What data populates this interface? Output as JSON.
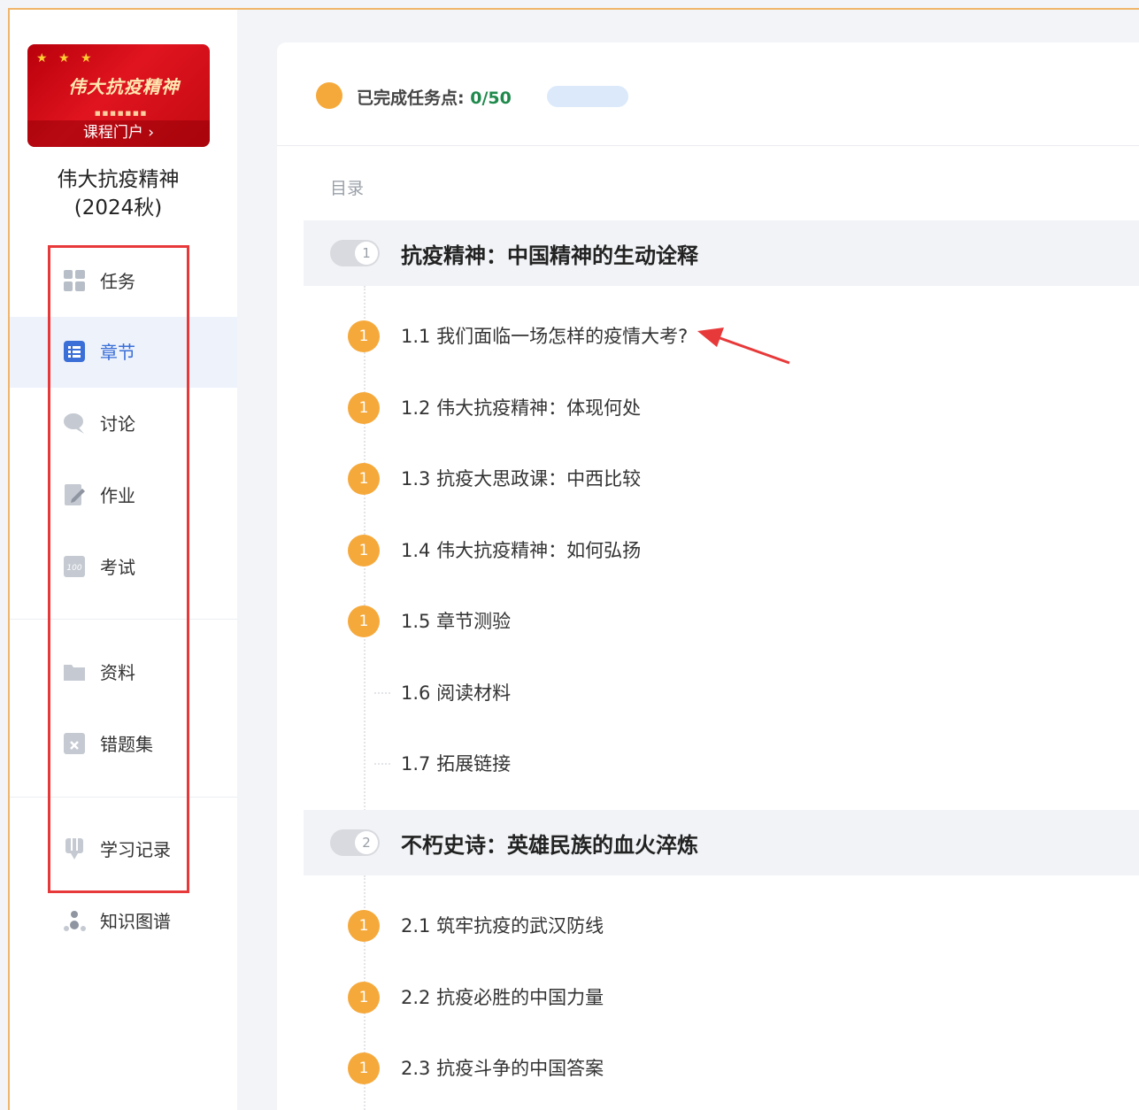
{
  "sidebar": {
    "banner": {
      "title": "伟大抗疫精神",
      "portal_label": "课程门户 ›"
    },
    "course_name_line1": "伟大抗疫精神",
    "course_name_line2": "(2024秋)",
    "nav": [
      {
        "label": "任务",
        "icon": "grid-icon"
      },
      {
        "label": "章节",
        "icon": "list-icon",
        "active": true
      },
      {
        "label": "讨论",
        "icon": "chat-bubble-icon"
      },
      {
        "label": "作业",
        "icon": "edit-document-icon"
      },
      {
        "label": "考试",
        "icon": "exam-score-icon"
      },
      {
        "label": "资料",
        "icon": "folder-icon"
      },
      {
        "label": "错题集",
        "icon": "wrong-questions-icon"
      },
      {
        "label": "学习记录",
        "icon": "bookmark-record-icon"
      },
      {
        "label": "知识图谱",
        "icon": "knowledge-graph-icon"
      }
    ]
  },
  "progress": {
    "label": "已完成任务点: ",
    "value": "0/50"
  },
  "toc_label": "目录",
  "chapters": [
    {
      "number": "1",
      "title": "抗疫精神：中国精神的生动诠释",
      "sections": [
        {
          "badge": "1",
          "title": "1.1 我们面临一场怎样的疫情大考?"
        },
        {
          "badge": "1",
          "title": "1.2 伟大抗疫精神：体现何处"
        },
        {
          "badge": "1",
          "title": "1.3 抗疫大思政课：中西比较"
        },
        {
          "badge": "1",
          "title": "1.4 伟大抗疫精神：如何弘扬"
        },
        {
          "badge": "1",
          "title": "1.5 章节测验"
        },
        {
          "badge": "",
          "title": "1.6 阅读材料"
        },
        {
          "badge": "",
          "title": "1.7 拓展链接"
        }
      ]
    },
    {
      "number": "2",
      "title": "不朽史诗：英雄民族的血火淬炼",
      "sections": [
        {
          "badge": "1",
          "title": "2.1 筑牢抗疫的武汉防线"
        },
        {
          "badge": "1",
          "title": "2.2 抗疫必胜的中国力量"
        },
        {
          "badge": "1",
          "title": "2.3 抗疫斗争的中国答案"
        }
      ]
    }
  ],
  "colors": {
    "accent": "#3a6fd8",
    "badge": "#f6a93b",
    "highlight_box": "#e8393a",
    "progress_value": "#1f8a4c"
  }
}
